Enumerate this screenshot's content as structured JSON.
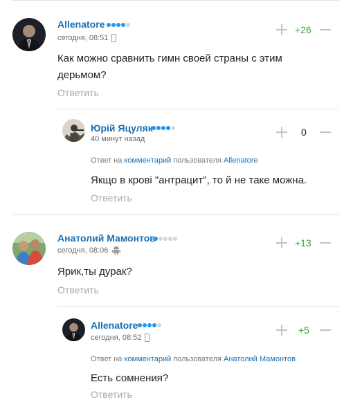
{
  "comments": [
    {
      "author": "Allenatore",
      "rating_dots": {
        "filled": 4,
        "total": 5
      },
      "time": "сегодня, 08:51",
      "device": "mobile-phone-icon",
      "score": "+26",
      "text": "Как можно сравнить гимн своей страны с этим дерьмом?",
      "reply_label": "Ответить"
    },
    {
      "author": "Юрій Яцуляк",
      "rating_dots": {
        "filled": 4,
        "total": 5
      },
      "time": "40 минут назад",
      "score": "0",
      "answer_prefix": "Ответ на",
      "answer_link": "комментарий",
      "answer_middle": "пользователя",
      "answer_user": "Allenatore",
      "text": "Якщо в крові \"антрацит\", то й не таке можна.",
      "reply_label": "Ответить"
    },
    {
      "author": "Анатолий Мамонтов",
      "rating_dots": {
        "filled": 1,
        "total": 5
      },
      "time": "сегодня, 08:06",
      "device": "android-icon",
      "score": "+13",
      "text": "Ярик,ты дурак?",
      "reply_label": "Ответить"
    },
    {
      "author": "Allenatore",
      "rating_dots": {
        "filled": 4,
        "total": 5
      },
      "time": "сегодня, 08:52",
      "device": "mobile-phone-icon",
      "score": "+5",
      "answer_prefix": "Ответ на",
      "answer_link": "комментарий",
      "answer_middle": "пользователя",
      "answer_user": "Анатолий Мамонтов",
      "text": "Есть сомнения?",
      "reply_label": "Ответить"
    }
  ],
  "colors": {
    "name": "#1b6fb1",
    "rating_on": "#2196f3",
    "rating_off": "#d6d6d6",
    "score_positive": "#3ba935",
    "muted": "#a9a9a9",
    "divider": "#e3e3e3"
  }
}
